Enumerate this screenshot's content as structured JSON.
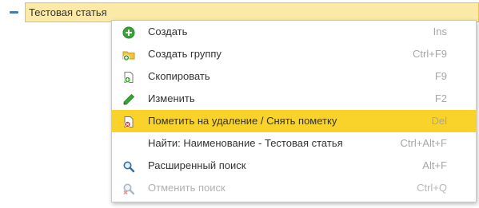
{
  "tree": {
    "selected_item_label": "Тестовая статья",
    "toggle_icon": "collapse-minus-icon"
  },
  "context_menu": {
    "items": [
      {
        "label": "Создать",
        "shortcut": "Ins",
        "icon": "create-icon",
        "enabled": true,
        "highlighted": false
      },
      {
        "label": "Создать группу",
        "shortcut": "Ctrl+F9",
        "icon": "folder-add-icon",
        "enabled": true,
        "highlighted": false
      },
      {
        "label": "Скопировать",
        "shortcut": "F9",
        "icon": "copy-icon",
        "enabled": true,
        "highlighted": false
      },
      {
        "label": "Изменить",
        "shortcut": "F2",
        "icon": "pencil-icon",
        "enabled": true,
        "highlighted": false
      },
      {
        "label": "Пометить на удаление / Снять пометку",
        "shortcut": "Del",
        "icon": "mark-delete-icon",
        "enabled": true,
        "highlighted": true
      },
      {
        "label": "Найти: Наименование - Тестовая статья",
        "shortcut": "Ctrl+Alt+F",
        "icon": "",
        "enabled": true,
        "highlighted": false
      },
      {
        "label": "Расширенный поиск",
        "shortcut": "Alt+F",
        "icon": "search-icon",
        "enabled": true,
        "highlighted": false
      },
      {
        "label": "Отменить поиск",
        "shortcut": "Ctrl+Q",
        "icon": "cancel-search-icon",
        "enabled": false,
        "highlighted": false
      }
    ]
  },
  "colors": {
    "selection_fill": "#fbeaa7",
    "selection_border": "#e2c44e",
    "menu_highlight": "#f9d22a",
    "shortcut_text": "#a6a6a6",
    "disabled_text": "#b1b1b1",
    "create_green": "#3aa335"
  }
}
